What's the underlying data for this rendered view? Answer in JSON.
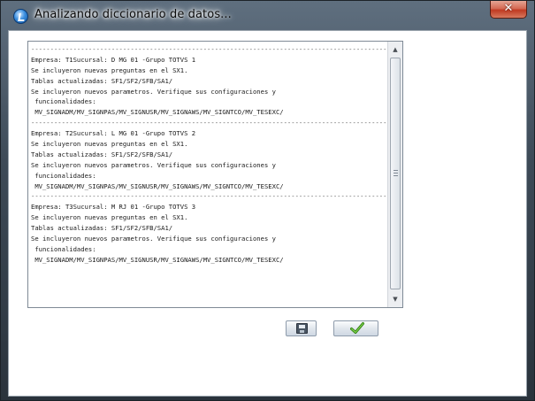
{
  "window": {
    "title": "Analizando diccionario de datos..."
  },
  "log": {
    "lines": [
      {
        "text": "--------------------------------------------------------------------------------------------------------",
        "kind": "sep"
      },
      {
        "text": "Empresa: T1Sucursal: D MG 01 -Grupo TOTVS 1",
        "kind": "text"
      },
      {
        "text": "Se incluyeron nuevas preguntas en el SX1.",
        "kind": "text"
      },
      {
        "text": "Tablas actualizadas: SF1/SF2/SFB/SA1/",
        "kind": "text"
      },
      {
        "text": "Se incluyeron nuevos parametros. Verifique sus configuraciones y",
        "kind": "text"
      },
      {
        "text": " funcionalidades:",
        "kind": "text"
      },
      {
        "text": " MV_SIGNADM/MV_SIGNPAS/MV_SIGNUSR/MV_SIGNAWS/MV_SIGNTCO/MV_TESEXC/",
        "kind": "text"
      },
      {
        "text": "--------------------------------------------------------------------------------------------------------",
        "kind": "sep"
      },
      {
        "text": "Empresa: T2Sucursal: L MG 01 -Grupo TOTVS 2",
        "kind": "text"
      },
      {
        "text": "Se incluyeron nuevas preguntas en el SX1.",
        "kind": "text"
      },
      {
        "text": "Tablas actualizadas: SF1/SF2/SFB/SA1/",
        "kind": "text"
      },
      {
        "text": "Se incluyeron nuevos parametros. Verifique sus configuraciones y",
        "kind": "text"
      },
      {
        "text": " funcionalidades:",
        "kind": "text"
      },
      {
        "text": " MV_SIGNADM/MV_SIGNPAS/MV_SIGNUSR/MV_SIGNAWS/MV_SIGNTCO/MV_TESEXC/",
        "kind": "text"
      },
      {
        "text": "--------------------------------------------------------------------------------------------------------",
        "kind": "sep"
      },
      {
        "text": "Empresa: T3Sucursal: M RJ 01 -Grupo TOTVS 3",
        "kind": "text"
      },
      {
        "text": "Se incluyeron nuevas preguntas en el SX1.",
        "kind": "text"
      },
      {
        "text": "Tablas actualizadas: SF1/SF2/SFB/SA1/",
        "kind": "text"
      },
      {
        "text": "Se incluyeron nuevos parametros. Verifique sus configuraciones y",
        "kind": "text"
      },
      {
        "text": " funcionalidades:",
        "kind": "text"
      },
      {
        "text": " MV_SIGNADM/MV_SIGNPAS/MV_SIGNUSR/MV_SIGNAWS/MV_SIGNTCO/MV_TESEXC/",
        "kind": "text"
      }
    ]
  },
  "buttons": {
    "save_icon": "save-icon",
    "ok_icon": "checkmark-icon"
  },
  "colors": {
    "close_button": "#c03a22",
    "checkmark": "#3a9a1a"
  }
}
